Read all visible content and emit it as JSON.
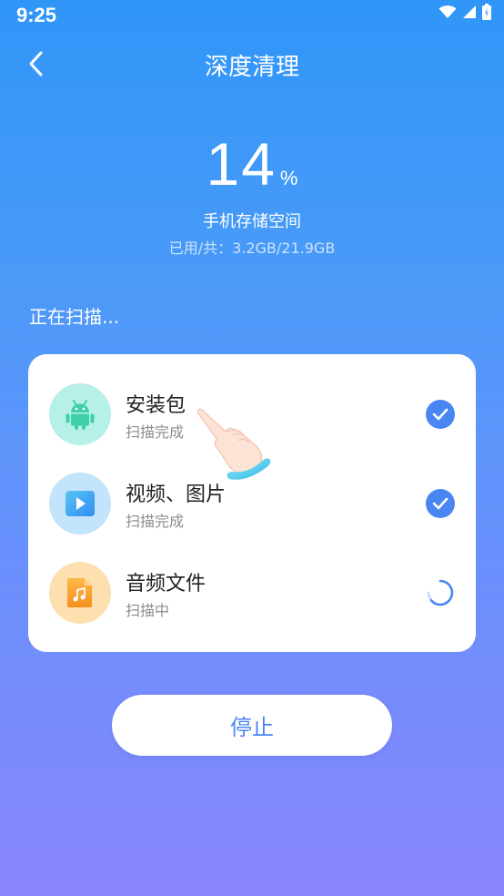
{
  "status_bar": {
    "time": "9:25"
  },
  "header": {
    "title": "深度清理"
  },
  "storage": {
    "percent": "14",
    "percent_unit": "%",
    "label": "手机存储空间",
    "usage": "已用/共：3.2GB/21.9GB"
  },
  "scan_status": "正在扫描...",
  "scan_items": [
    {
      "title": "安装包",
      "status": "扫描完成",
      "icon": "android-icon",
      "state": "done"
    },
    {
      "title": "视频、图片",
      "status": "扫描完成",
      "icon": "video-icon",
      "state": "done"
    },
    {
      "title": "音频文件",
      "status": "扫描中",
      "icon": "music-icon",
      "state": "scanning"
    }
  ],
  "stop_button": {
    "label": "停止"
  },
  "colors": {
    "accent": "#4a86f2",
    "android_icon_bg": "#b6f0e6",
    "video_icon_bg": "#c4e4fb",
    "music_icon_bg": "#fde0b0"
  }
}
